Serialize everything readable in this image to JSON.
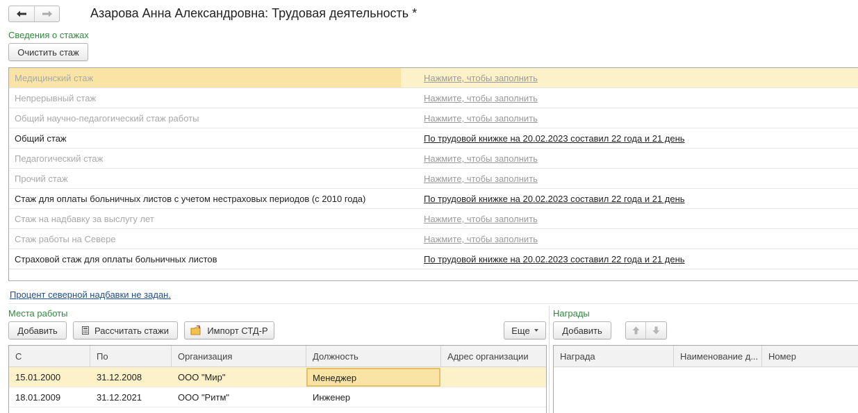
{
  "header": {
    "back_icon": "arrow-left-icon",
    "forward_icon": "arrow-right-icon",
    "title": "Азарова Анна Александровна: Трудовая деятельность *"
  },
  "stazh": {
    "section_title": "Сведения о стажах",
    "clear_button": "Очистить стаж",
    "rows": [
      {
        "name": "Медицинский стаж",
        "value": "Нажмите, чтобы заполнить",
        "filled": false,
        "selected": true
      },
      {
        "name": "Непрерывный стаж",
        "value": "Нажмите, чтобы заполнить",
        "filled": false,
        "selected": false
      },
      {
        "name": "Общий научно-педагогический стаж работы",
        "value": "Нажмите, чтобы заполнить",
        "filled": false,
        "selected": false
      },
      {
        "name": "Общий стаж",
        "value": "По трудовой книжке на 20.02.2023 составил 22 года и 21 день",
        "filled": true,
        "selected": false
      },
      {
        "name": "Педагогический стаж",
        "value": "Нажмите, чтобы заполнить",
        "filled": false,
        "selected": false
      },
      {
        "name": "Прочий стаж",
        "value": "Нажмите, чтобы заполнить",
        "filled": false,
        "selected": false
      },
      {
        "name": "Стаж для оплаты больничных листов с учетом нестраховых периодов (с 2010 года)",
        "value": "По трудовой книжке на 20.02.2023 составил 22 года и 21 день",
        "filled": true,
        "selected": false
      },
      {
        "name": "Стаж на надбавку за выслугу лет",
        "value": "Нажмите, чтобы заполнить",
        "filled": false,
        "selected": false
      },
      {
        "name": "Стаж работы на Севере",
        "value": "Нажмите, чтобы заполнить",
        "filled": false,
        "selected": false
      },
      {
        "name": "Страховой стаж для оплаты больничных листов",
        "value": "По трудовой книжке на 20.02.2023 составил 22 года и 21 день",
        "filled": true,
        "selected": false
      }
    ]
  },
  "north_link": "Процент северной надбавки не задан.",
  "workplaces": {
    "section_title": "Места работы",
    "add_button": "Добавить",
    "calc_button": "Рассчитать стажи",
    "calc_icon": "calculator-icon",
    "import_button": "Импорт СТД-Р",
    "import_icon": "folder-import-icon",
    "more_button": "Еще",
    "columns": [
      "С",
      "По",
      "Организация",
      "Должность",
      "Адрес организации"
    ],
    "rows": [
      {
        "from": "15.01.2000",
        "to": "31.12.2008",
        "org": "ООО \"Мир\"",
        "position": "Менеджер",
        "address": "",
        "selected": true
      },
      {
        "from": "18.01.2009",
        "to": "31.12.2021",
        "org": "ООО \"Ритм\"",
        "position": "Инженер",
        "address": "",
        "selected": false
      }
    ]
  },
  "awards": {
    "section_title": "Награды",
    "add_button": "Добавить",
    "up_icon": "arrow-up-icon",
    "down_icon": "arrow-down-icon",
    "columns": [
      "Награда",
      "Наименование д...",
      "Номер"
    ]
  },
  "colors": {
    "section_green": "#2e8b3c",
    "selection_yellow": "#fcf1c8",
    "focus_yellow": "#f9e4a5",
    "link_blue": "#1f4f8f"
  }
}
